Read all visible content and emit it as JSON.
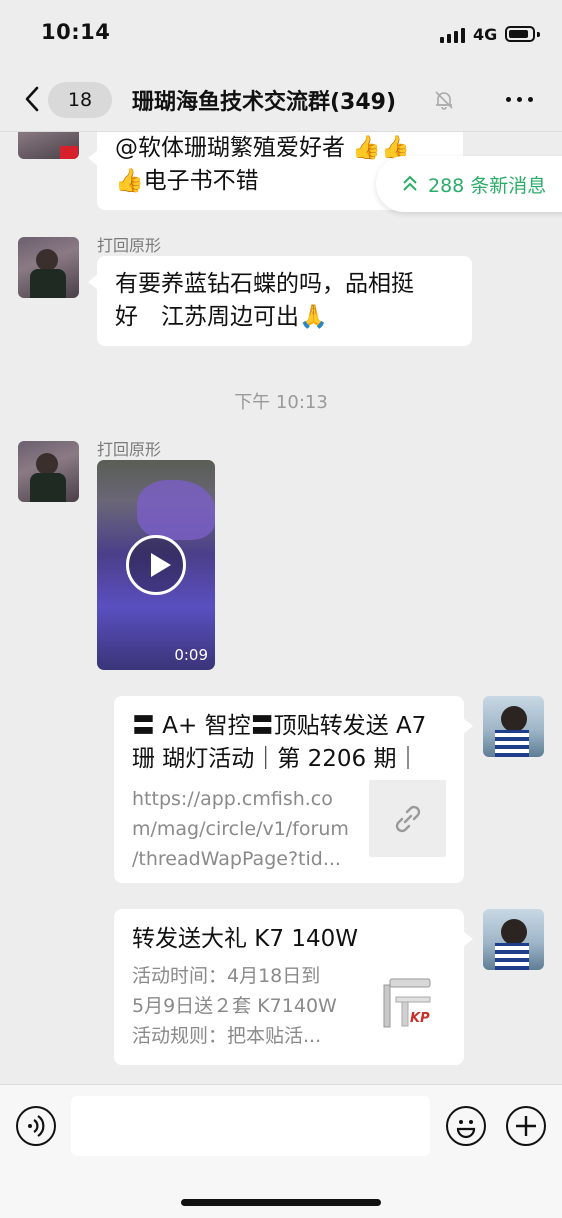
{
  "status_bar": {
    "time": "10:14",
    "network": "4G",
    "battery_level": 0.85
  },
  "nav": {
    "back_badge": "18",
    "title": "珊瑚海鱼技术交流群(349)"
  },
  "new_messages": {
    "label": "288 条新消息"
  },
  "messages": [
    {
      "type": "text",
      "sender": "",
      "lines": [
        "@软体珊瑚繁殖爱好者 👍👍",
        "👍电子书不错"
      ]
    },
    {
      "type": "text",
      "sender": "打回原形",
      "lines": [
        "有要养蓝钻石蝶的吗，品相挺",
        "好　江苏周边可出🙏"
      ]
    },
    {
      "type": "timestamp",
      "text": "下午 10:13"
    },
    {
      "type": "video",
      "sender": "打回原形",
      "duration": "0:09"
    },
    {
      "type": "link",
      "title_lines": [
        "〓 A+ 智控〓顶贴转发送 A7",
        "珊 瑚灯活动｜第 2206 期｜"
      ],
      "desc_lines": [
        "https://app.cmfish.co",
        "m/mag/circle/v1/forum",
        "/threadWapPage?tid..."
      ],
      "icon": "link-icon"
    },
    {
      "type": "link",
      "title_lines": [
        "转发送大礼 K7 140W"
      ],
      "desc_lines": [
        "活动时间：4月18日到",
        "5月9日送２套 K7140W",
        "活动规则：把本贴活..."
      ],
      "thumb_label": "KP",
      "icon": "lamp-image"
    }
  ],
  "input": {
    "placeholder": "",
    "voice_icon": "voice-icon",
    "emoji_icon": "emoji-icon",
    "plus_icon": "plus-icon"
  }
}
